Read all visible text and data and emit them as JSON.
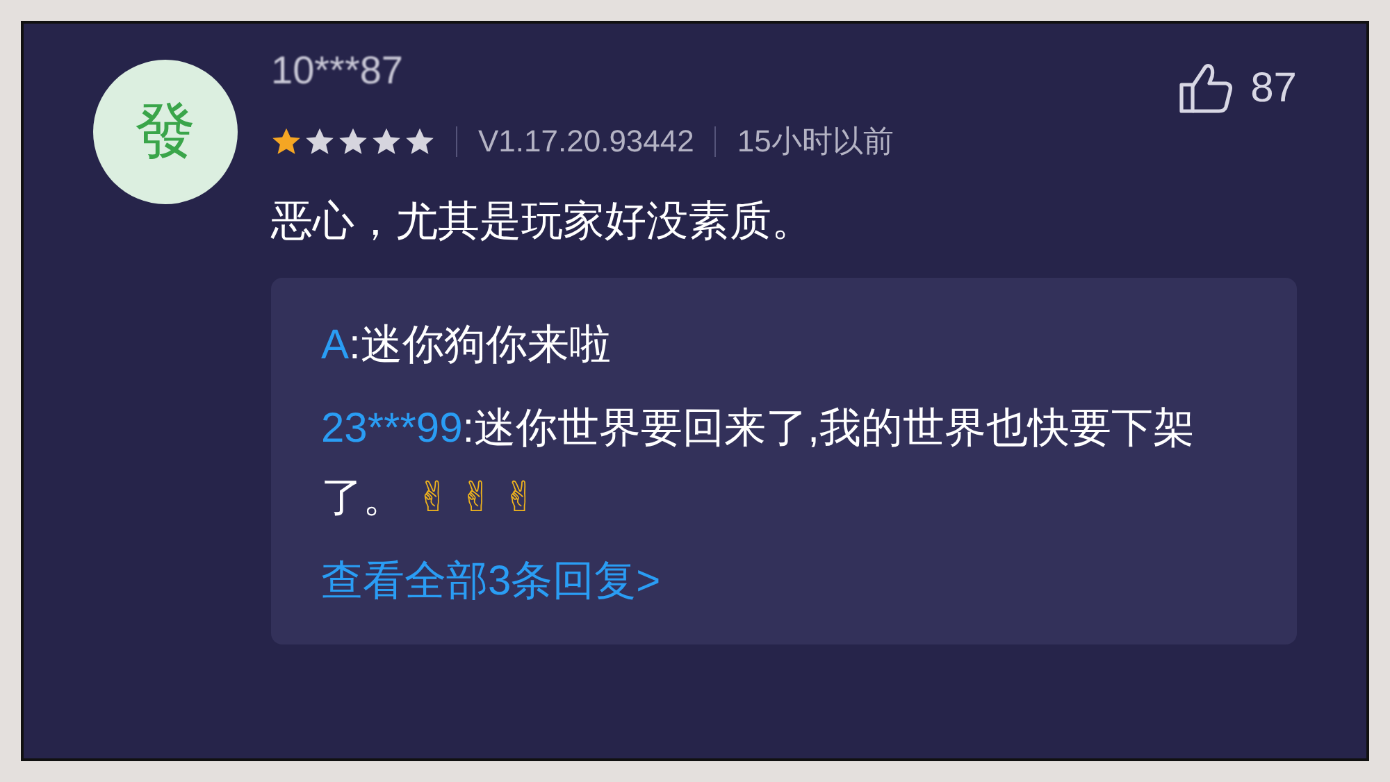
{
  "comment": {
    "avatar": "發",
    "username": "10***87",
    "stars": 1,
    "version": "V1.17.20.93442",
    "time": "15小时以前",
    "likes": "87",
    "text": "恶心，尤其是玩家好没素质。"
  },
  "replies": [
    {
      "user": "A",
      "text": ":迷你狗你来啦"
    },
    {
      "user": "23***99",
      "text": ":迷你世界要回来了,我的世界也快要下架了。",
      "emoji": "✌✌✌"
    }
  ],
  "more_link": "查看全部3条回复>"
}
